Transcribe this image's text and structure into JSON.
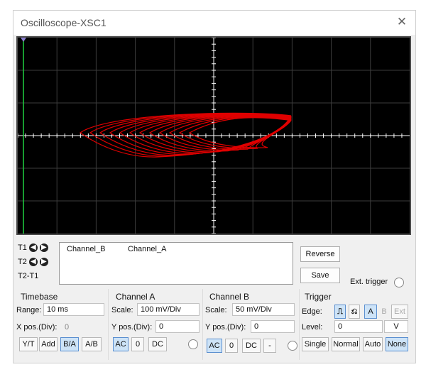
{
  "window": {
    "title": "Oscilloscope-XSC1",
    "close_glyph": "✕"
  },
  "colors": {
    "trace": "#e00000",
    "grid": "#3c3c3c",
    "screen": "#000000",
    "cursor": "#1fcf3f"
  },
  "readout": {
    "t1": "T1",
    "t2": "T2",
    "t2t1": "T2-T1",
    "channel_b": "Channel_B",
    "channel_a": "Channel_A"
  },
  "buttons": {
    "reverse": "Reverse",
    "save": "Save",
    "ext_trigger": "Ext. trigger"
  },
  "timebase": {
    "title": "Timebase",
    "range_label": "Range:",
    "range_value": "10 ms",
    "xpos_label": "X pos.(Div):",
    "xpos_value": "0",
    "modes": [
      "Y/T",
      "Add",
      "B/A",
      "A/B"
    ],
    "active_mode": "B/A"
  },
  "channel_a": {
    "title": "Channel A",
    "scale_label": "Scale:",
    "scale_value": "100 mV/Div",
    "ypos_label": "Y pos.(Div):",
    "ypos_value": "0",
    "coupling": [
      "AC",
      "0",
      "DC"
    ]
  },
  "channel_b": {
    "title": "Channel B",
    "scale_label": "Scale:",
    "scale_value": "50 mV/Div",
    "ypos_label": "Y pos.(Div):",
    "ypos_value": "0",
    "coupling": [
      "AC",
      "0",
      "DC",
      "-"
    ]
  },
  "trigger": {
    "title": "Trigger",
    "edge_label": "Edge:",
    "sources": [
      "A",
      "B",
      "Ext"
    ],
    "level_label": "Level:",
    "level_value": "0",
    "level_unit": "V",
    "modes": [
      "Single",
      "Normal",
      "Auto",
      "None"
    ],
    "active_mode": "None"
  }
}
